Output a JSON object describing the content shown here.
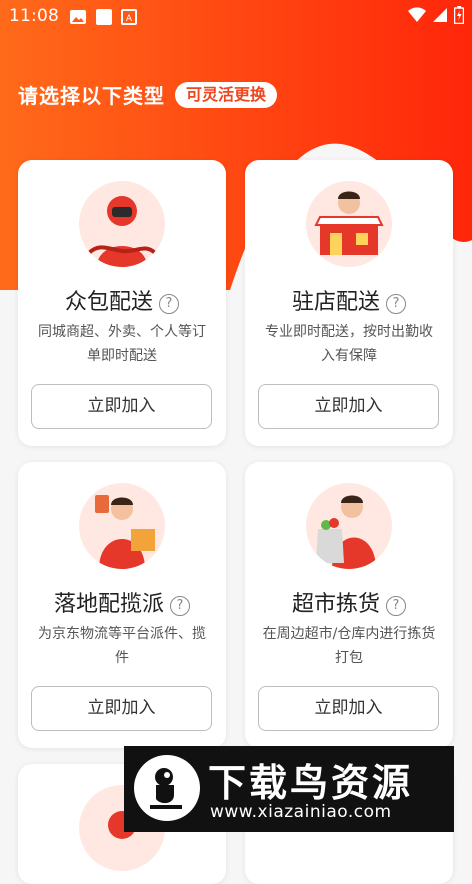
{
  "status_bar": {
    "time": "11:08"
  },
  "header": {
    "title": "请选择以下类型",
    "chip": "可灵活更换"
  },
  "colors": {
    "accent": "#f0461d",
    "gradient_start": "#ff6a1a",
    "gradient_end": "#ff2a0a"
  },
  "cards": [
    {
      "name": "众包配送",
      "help": "?",
      "desc": "同城商超、外卖、个人等订单即时配送",
      "button": "立即加入",
      "icon": "delivery-rider-icon"
    },
    {
      "name": "驻店配送",
      "help": "?",
      "desc": "专业即时配送，按时出勤收入有保障",
      "button": "立即加入",
      "icon": "store-courier-icon"
    },
    {
      "name": "落地配揽派",
      "help": "?",
      "desc": "为京东物流等平台派件、揽件",
      "button": "立即加入",
      "icon": "parcel-courier-icon"
    },
    {
      "name": "超市拣货",
      "help": "?",
      "desc": "在周边超市/仓库内进行拣货打包",
      "button": "立即加入",
      "icon": "grocery-picker-icon"
    }
  ],
  "watermark": {
    "title": "下载鸟资源",
    "url": "www.xiazainiao.com"
  }
}
